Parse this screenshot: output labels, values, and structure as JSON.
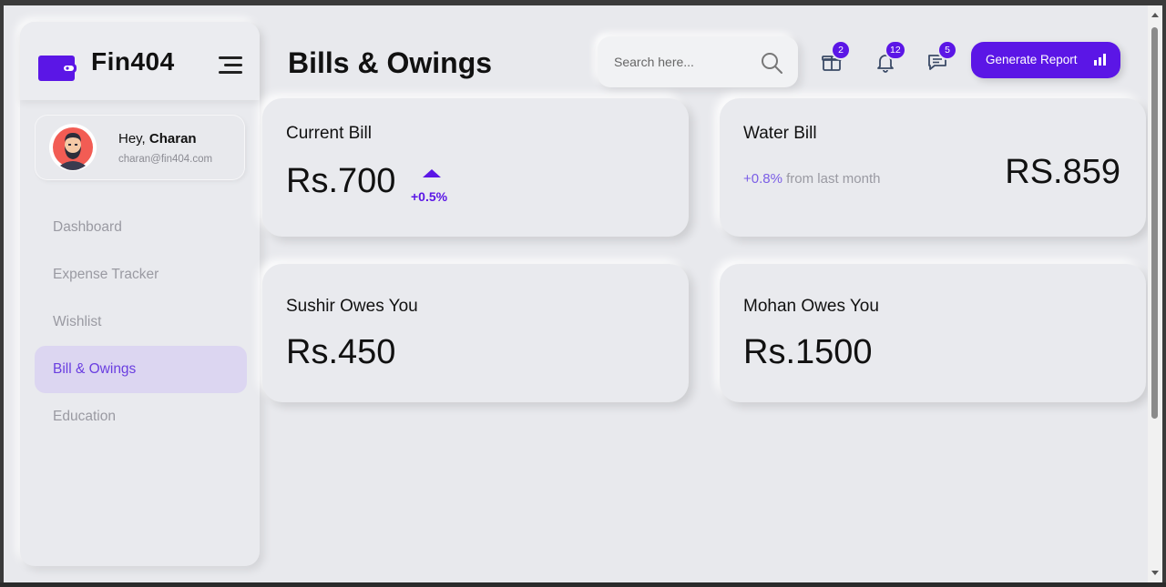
{
  "brand": {
    "name": "Fin404"
  },
  "user": {
    "greeting_prefix": "Hey,",
    "name": "Charan",
    "email": "charan@fin404.com"
  },
  "nav": {
    "items": [
      {
        "label": "Dashboard",
        "active": false
      },
      {
        "label": "Expense Tracker",
        "active": false
      },
      {
        "label": "Wishlist",
        "active": false
      },
      {
        "label": "Bill & Owings",
        "active": true
      },
      {
        "label": "Education",
        "active": false
      }
    ]
  },
  "header": {
    "title": "Bills & Owings",
    "search_placeholder": "Search here...",
    "badges": {
      "gift": "2",
      "notifications": "12",
      "messages": "5"
    },
    "report_button": "Generate Report"
  },
  "cards": {
    "current_bill": {
      "title": "Current Bill",
      "amount": "Rs.700",
      "change": "+0.5%"
    },
    "water_bill": {
      "title": "Water Bill",
      "change": "+0.8%",
      "change_suffix": "from last month",
      "amount": "RS.859"
    },
    "sushir": {
      "title": "Sushir Owes You",
      "amount": "Rs.450"
    },
    "mohan": {
      "title": "Mohan Owes You",
      "amount": "Rs.1500"
    }
  },
  "colors": {
    "accent": "#5b16e6",
    "active_nav_bg": "#dcd6f1",
    "background": "#e8e9ed"
  },
  "icons": [
    "wallet-icon",
    "menu-icon",
    "search-icon",
    "gift-icon",
    "bell-icon",
    "chat-icon",
    "bar-chart-icon"
  ]
}
